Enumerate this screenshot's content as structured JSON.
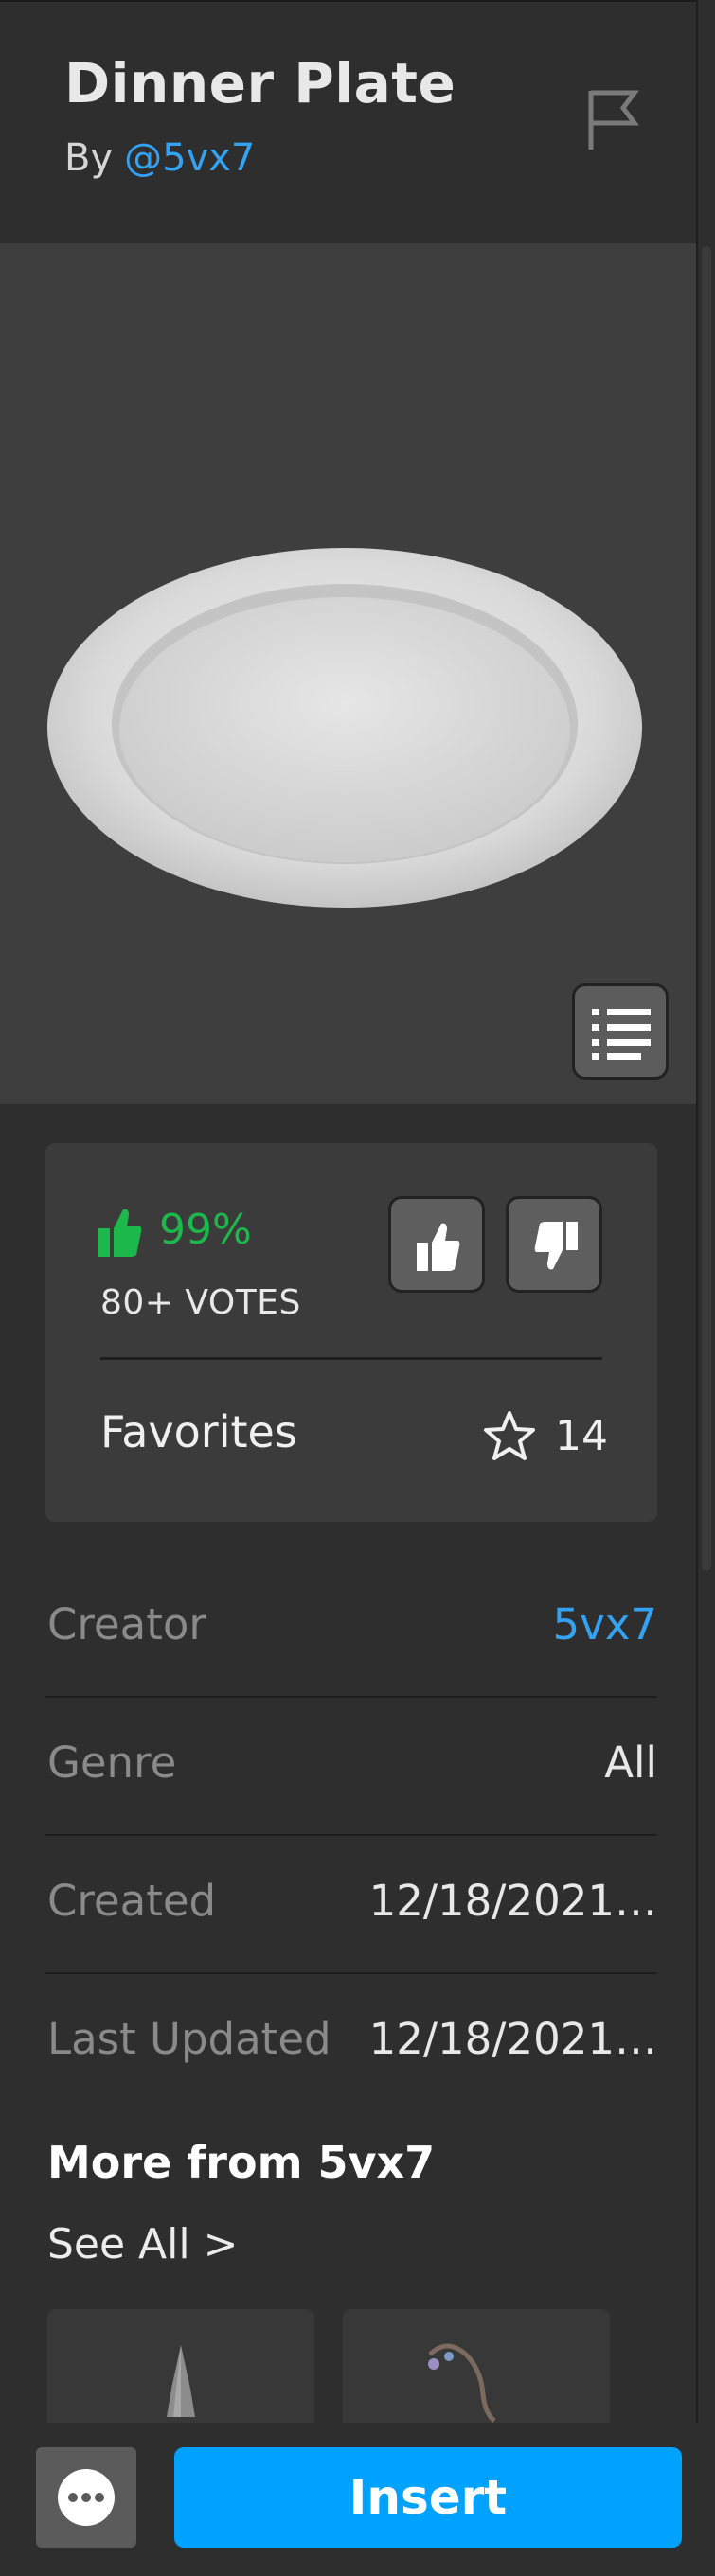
{
  "asset": {
    "title": "Dinner Plate",
    "by_prefix": "By",
    "by_handle": "@5vx7"
  },
  "rating": {
    "percent": "99%",
    "votes": "80+ VOTES",
    "favorites_label": "Favorites",
    "favorites_count": "14"
  },
  "details": [
    {
      "label": "Creator",
      "value": "5vx7",
      "is_link": true
    },
    {
      "label": "Genre",
      "value": "All"
    },
    {
      "label": "Created",
      "value": "12/18/2021…"
    },
    {
      "label": "Last Updated",
      "value": "12/18/2021…"
    }
  ],
  "more": {
    "title": "More from 5vx7",
    "see_all": "See All >"
  },
  "actions": {
    "insert_label": "Insert"
  },
  "colors": {
    "background": "#2e2e2e",
    "link": "#33a2f2",
    "positive": "#1cb84b",
    "insert": "#00a2ff"
  }
}
